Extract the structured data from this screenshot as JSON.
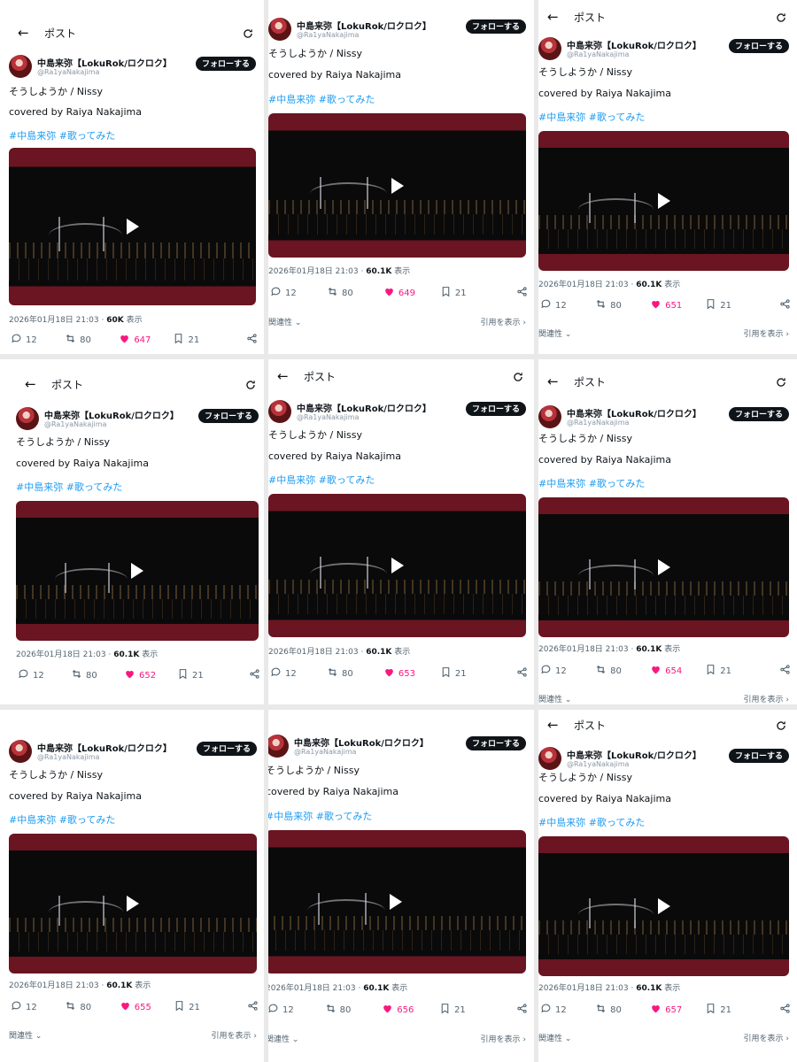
{
  "screen_title": "ポスト",
  "user": {
    "display_name": "中島来弥【LokuRok/ロクロク】",
    "handle": "@Ra1yaNakajima"
  },
  "follow_label": "フォローする",
  "tweet": {
    "line1": "そうしようか / Nissy",
    "line2": "covered by Raiya Nakajima",
    "hashtags": "#中島来弥 #歌ってみた"
  },
  "timestamp": "2026年01月18日 21:03",
  "views_suffix": "表示",
  "related_label": "関連性",
  "quote_label": "引用を表示",
  "panels": [
    {
      "views": "60K",
      "replies": "12",
      "reposts": "80",
      "likes": "647",
      "bookmarks": "21"
    },
    {
      "views": "60.1K",
      "replies": "12",
      "reposts": "80",
      "likes": "649",
      "bookmarks": "21"
    },
    {
      "views": "60.1K",
      "replies": "12",
      "reposts": "80",
      "likes": "651",
      "bookmarks": "21"
    },
    {
      "views": "60.1K",
      "replies": "12",
      "reposts": "80",
      "likes": "652",
      "bookmarks": "21"
    },
    {
      "views": "60.1K",
      "replies": "12",
      "reposts": "80",
      "likes": "653",
      "bookmarks": "21"
    },
    {
      "views": "60.1K",
      "replies": "12",
      "reposts": "80",
      "likes": "654",
      "bookmarks": "21"
    },
    {
      "views": "60.1K",
      "replies": "12",
      "reposts": "80",
      "likes": "655",
      "bookmarks": "21"
    },
    {
      "views": "60.1K",
      "replies": "12",
      "reposts": "80",
      "likes": "656",
      "bookmarks": "21"
    },
    {
      "views": "60.1K",
      "replies": "12",
      "reposts": "80",
      "likes": "657",
      "bookmarks": "21"
    }
  ],
  "colors": {
    "accent": "#1d9bf0",
    "like": "#f91880",
    "video_band": "#6a1521"
  }
}
